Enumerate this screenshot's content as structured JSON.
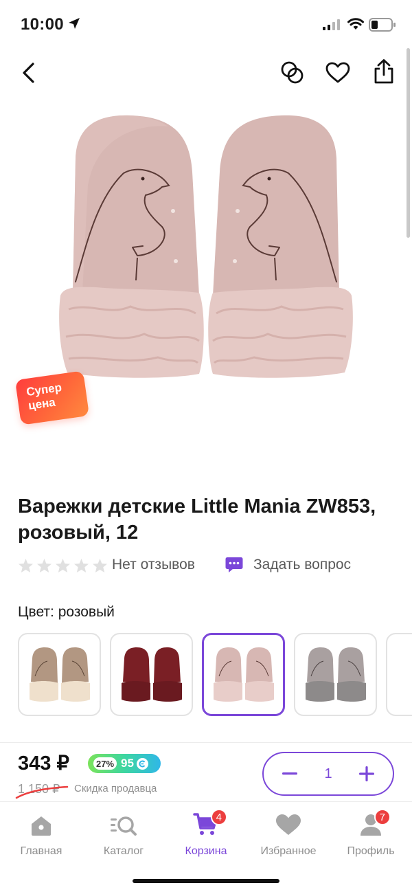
{
  "status_bar": {
    "time": "10:00"
  },
  "promo_badge": {
    "line1": "Супер",
    "line2": "цена"
  },
  "product": {
    "title": "Варежки детские Little Mania ZW853, розовый, 12",
    "reviews": "Нет отзывов",
    "ask_question": "Задать вопрос",
    "color_label": "Цвет: розовый"
  },
  "colors": {
    "accent": "#7b47d9",
    "badge_red": "#ec3e3e",
    "mitten_pink": "#d9b8b4",
    "mitten_beige": "#b59b86",
    "mitten_burgundy": "#7a1f25",
    "mitten_gray": "#a9a0a0"
  },
  "swatches": [
    {
      "name": "beige",
      "selected": false
    },
    {
      "name": "burgundy",
      "selected": false
    },
    {
      "name": "pink",
      "selected": true
    },
    {
      "name": "gray",
      "selected": false
    }
  ],
  "price_panel": {
    "price": "343 ₽",
    "bonus_percent": "27%",
    "bonus_value": "95",
    "old_price": "1 150 ₽",
    "discount_label": "Скидка продавца",
    "quantity": "1"
  },
  "tab_bar": {
    "tabs": [
      {
        "label": "Главная",
        "icon": "home-icon"
      },
      {
        "label": "Каталог",
        "icon": "catalog-icon"
      },
      {
        "label": "Корзина",
        "icon": "cart-icon",
        "badge": "4",
        "active": true
      },
      {
        "label": "Избранное",
        "icon": "heart-icon"
      },
      {
        "label": "Профиль",
        "icon": "profile-icon",
        "badge": "7"
      }
    ]
  }
}
